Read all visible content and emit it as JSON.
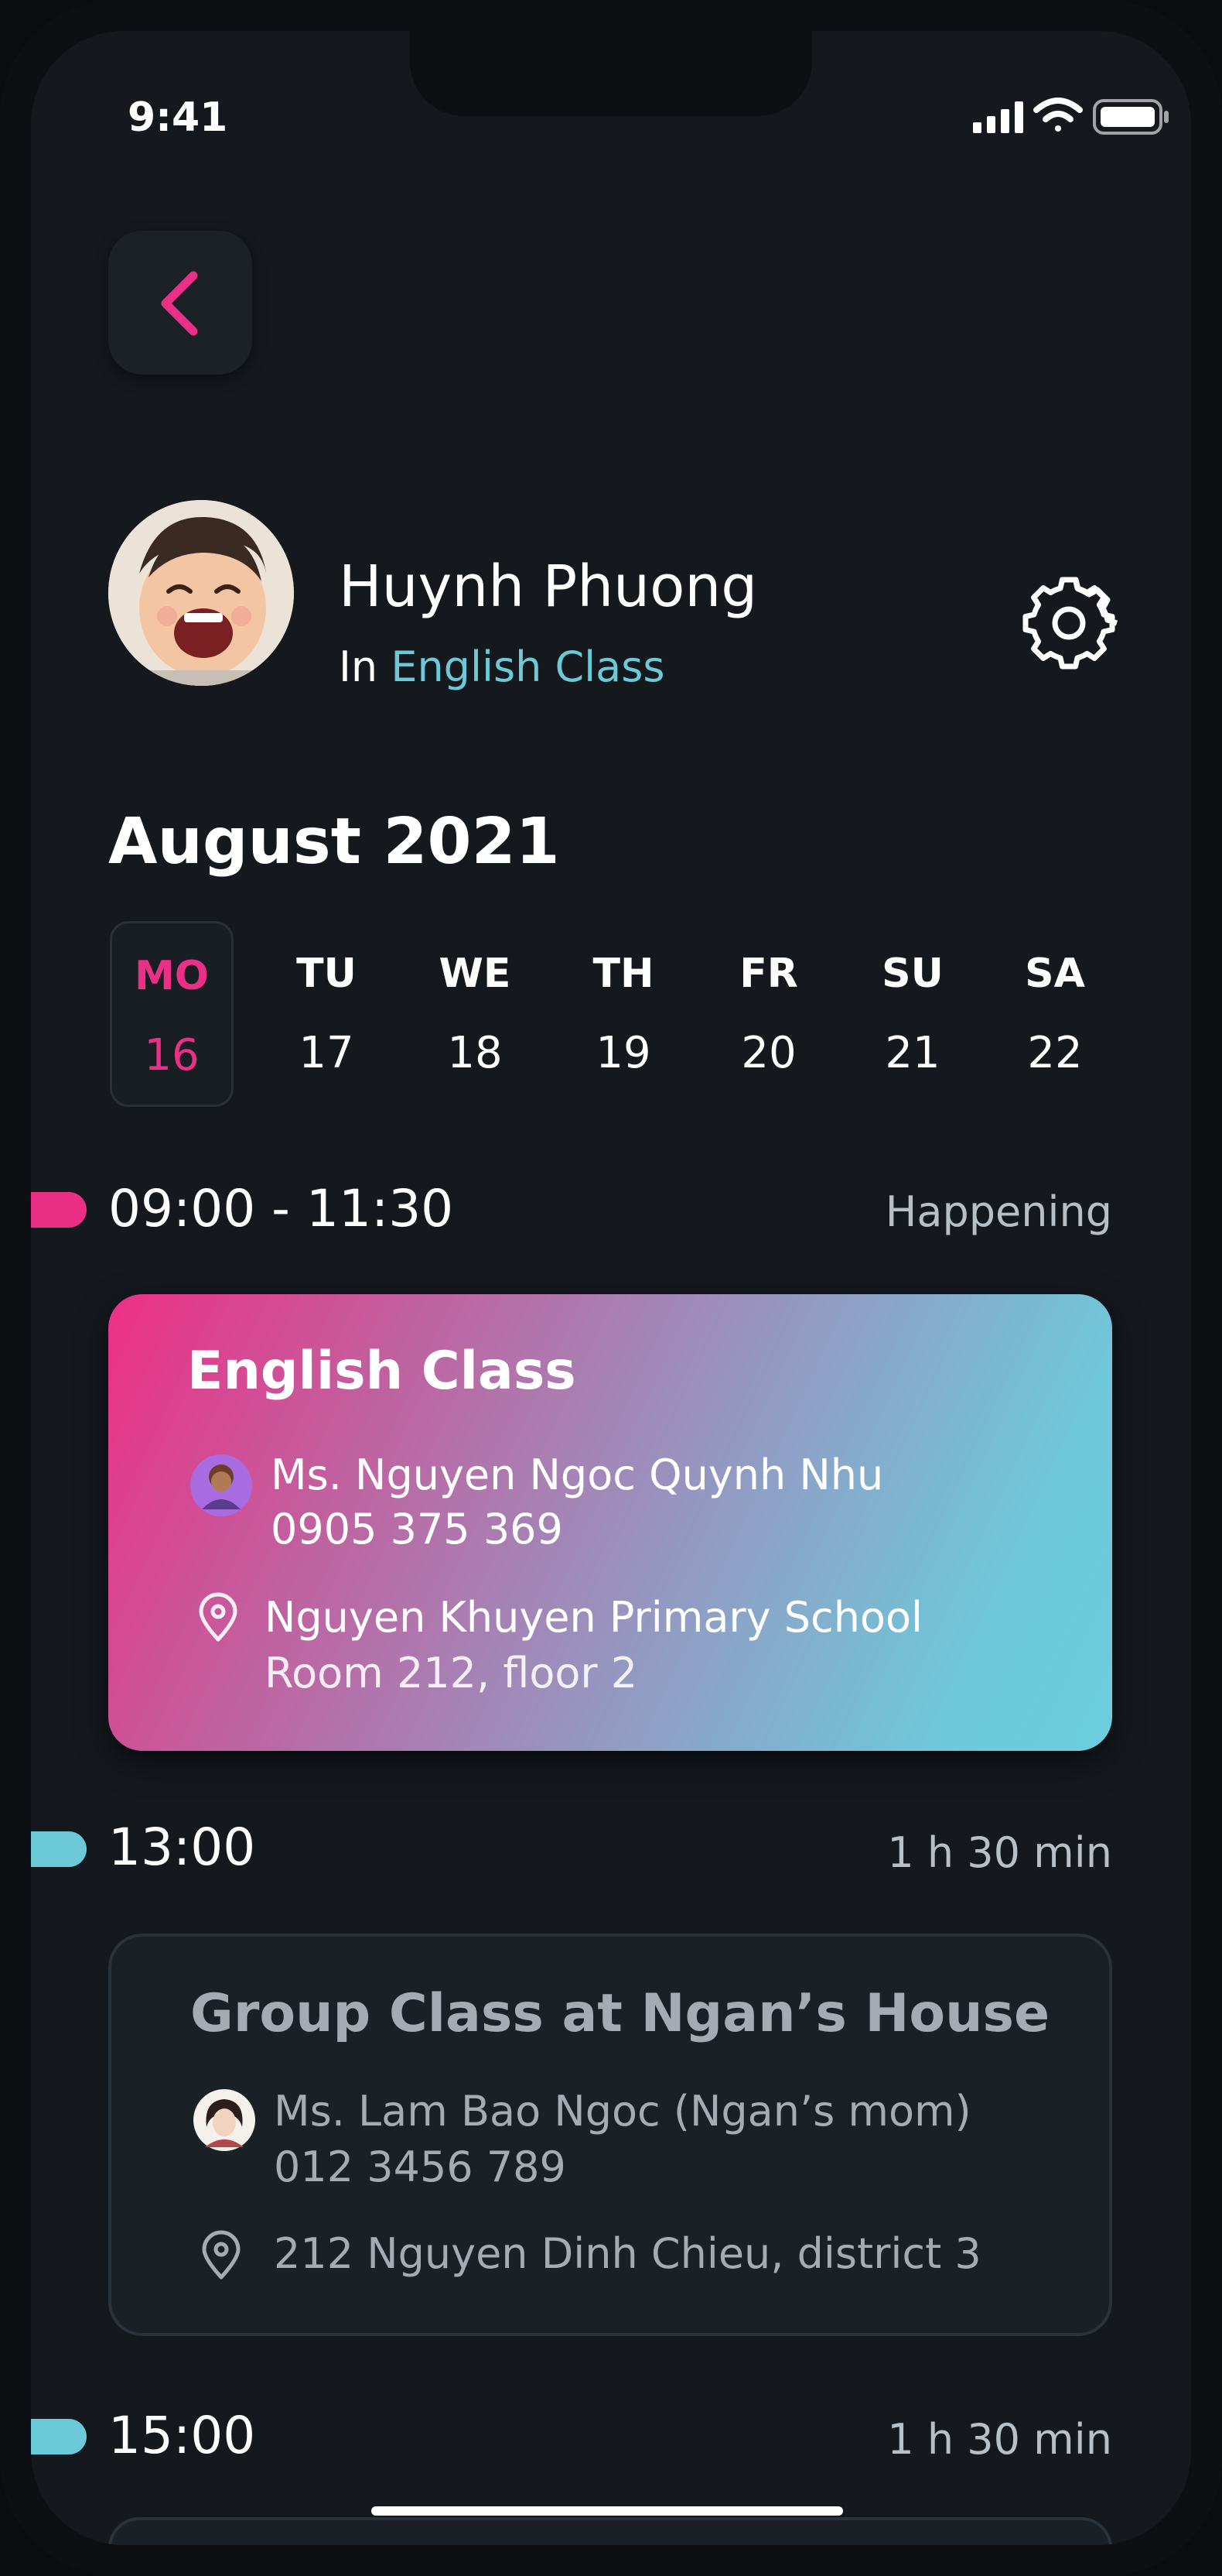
{
  "status_bar": {
    "time": "9:41"
  },
  "header": {
    "user_name": "Huynh Phuong",
    "class_prefix": "In",
    "class_name": "English Class"
  },
  "calendar": {
    "month_label": "August  2021",
    "days": [
      {
        "name": "MO",
        "date": "16",
        "selected": true
      },
      {
        "name": "TU",
        "date": "17"
      },
      {
        "name": "WE",
        "date": "18"
      },
      {
        "name": "TH",
        "date": "19"
      },
      {
        "name": "FR",
        "date": "20"
      },
      {
        "name": "SU",
        "date": "21"
      },
      {
        "name": "SA",
        "date": "22"
      }
    ]
  },
  "schedule": [
    {
      "time": "09:00 - 11:30",
      "meta": "Happening",
      "marker_color": "#ea2f87",
      "title": "English Class",
      "teacher": "Ms. Nguyen Ngoc Quynh Nhu",
      "phone": "0905 375 369",
      "location": "Nguyen Khuyen Primary School",
      "room": "Room 212, floor 2"
    },
    {
      "time": "13:00",
      "meta": "1 h 30 min",
      "marker_color": "#6ccad8",
      "title": "Group Class at Ngan’s House",
      "teacher": "Ms. Lam Bao Ngoc (Ngan’s mom)",
      "phone": "012 3456 789",
      "location": "212 Nguyen Dinh Chieu, district 3"
    },
    {
      "time": "15:00",
      "meta": "1 h 30 min",
      "marker_color": "#6ccad8"
    }
  ],
  "colors": {
    "accent_pink": "#ea2f87",
    "accent_cyan": "#6ccad8",
    "background": "#15191e"
  },
  "icons": [
    "back-chevron-icon",
    "gear-icon",
    "location-pin-icon",
    "signal-icon",
    "wifi-icon",
    "battery-icon"
  ]
}
